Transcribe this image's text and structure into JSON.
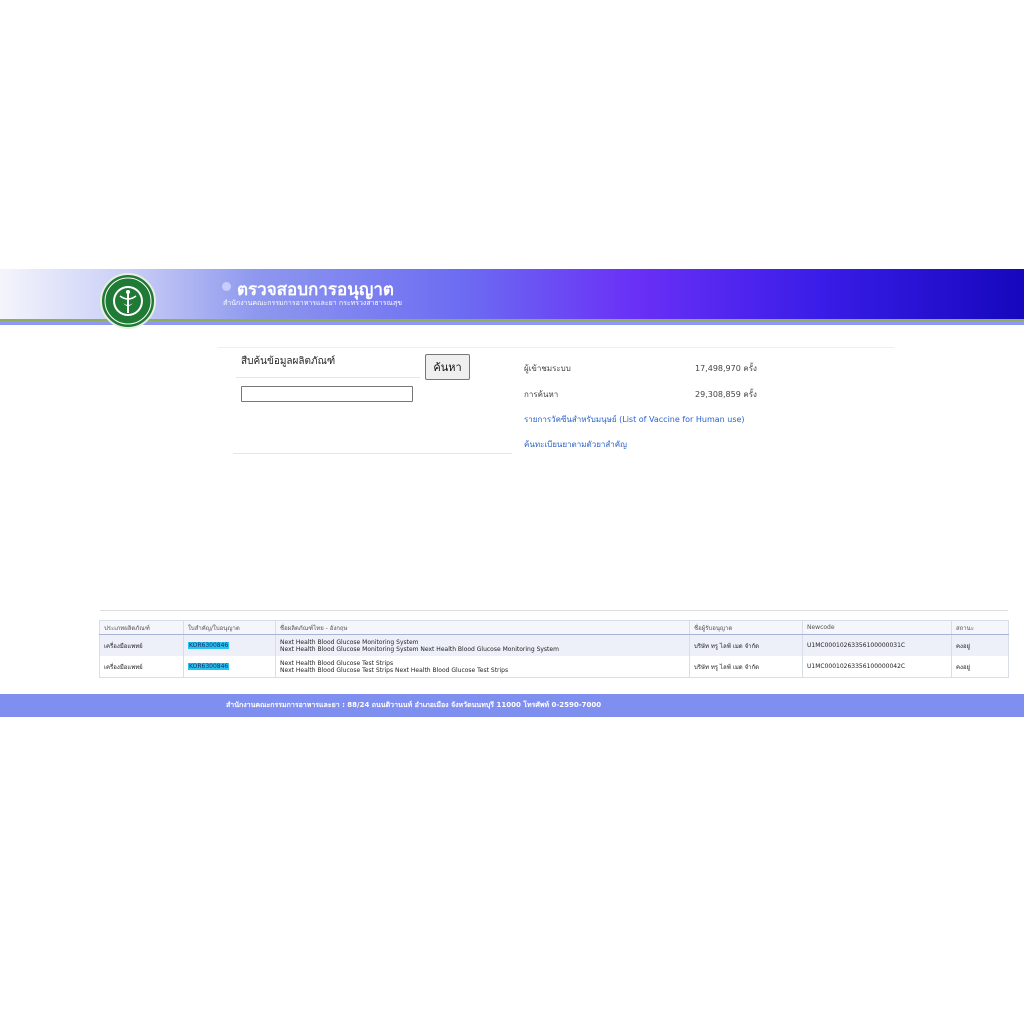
{
  "header": {
    "title": "ตรวจสอบการอนุญาต",
    "subtitle": "สำนักงานคณะกรรมการอาหารและยา กระทรวงสาธารณสุข",
    "logo_text": "กระทรวงสาธารณสุข MINISTRY OF PUBLIC HEALTH"
  },
  "search": {
    "label": "สืบค้นข้อมูลผลิตภัณฑ์",
    "button_label": "ค้นหา",
    "input_value": ""
  },
  "stats": {
    "visitors_label": "ผู้เข้าชมระบบ",
    "visitors_value": "17,498,970 ครั้ง",
    "searches_label": "การค้นหา",
    "searches_value": "29,308,859 ครั้ง"
  },
  "links": {
    "vaccine": "รายการวัคซีนสำหรับมนุษย์ (List of Vaccine for Human use)",
    "drug_search": "ค้นทะเบียนยาตามตัวยาสำคัญ"
  },
  "table": {
    "headers": [
      "ประเภทผลิตภัณฑ์",
      "ใบสำคัญ/ใบอนุญาต",
      "ชื่อผลิตภัณฑ์ไทย - อังกฤษ",
      "ชื่อผู้รับอนุญาต",
      "Newcode",
      "สถานะ"
    ],
    "rows": [
      {
        "type": "เครื่องมือแพทย์",
        "license": "KOR6300846",
        "name_line1": "Next Health Blood Glucose Monitoring System",
        "name_line2": "Next Health Blood Glucose Monitoring System Next Health Blood Glucose Monitoring System",
        "licensee": "บริษัท ทรู ไลฟ์ เมด จำกัด",
        "newcode": "U1MC00010263356100000031C",
        "status": "คงอยู่"
      },
      {
        "type": "เครื่องมือแพทย์",
        "license": "KOR6300846",
        "name_line1": "Next Health Blood Glucose Test Strips",
        "name_line2": "Next Health Blood Glucose Test Strips Next Health Blood Glucose Test Strips",
        "licensee": "บริษัท ทรู ไลฟ์ เมด จำกัด",
        "newcode": "U1MC00010263356100000042C",
        "status": "คงอยู่"
      }
    ]
  },
  "footer": {
    "text": "สำนักงานคณะกรรมการอาหารและยา : 88/24 ถนนติวานนท์ อำเภอเมือง จังหวัดนนทบุรี 11000 โทรศัพท์ 0-2590-7000"
  },
  "colors": {
    "header_gradient_start": "#f4f5fc",
    "header_gradient_end": "#1607bd",
    "footer_bg": "#7f8ff0",
    "link": "#2a63c9",
    "license_highlight": "#29c3f2",
    "logo_green": "#1e7a35"
  }
}
